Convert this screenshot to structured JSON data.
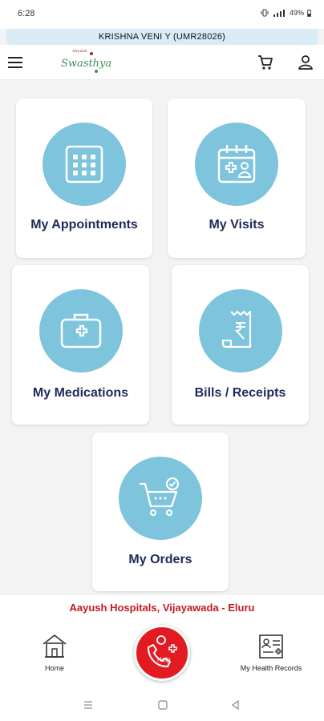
{
  "status": {
    "time": "6:28",
    "battery": "49%"
  },
  "patient": {
    "name": "KRISHNA VENI Y (UMR28026)"
  },
  "logo": {
    "small_text": "Aayush",
    "brand_text": "Swasthya"
  },
  "cards": [
    {
      "label": "My Appointments",
      "icon": "calendar-grid-icon"
    },
    {
      "label": "My Visits",
      "icon": "calendar-medical-icon"
    },
    {
      "label": "My Medications",
      "icon": "medical-kit-icon"
    },
    {
      "label": "Bills / Receipts",
      "icon": "rupee-receipt-icon"
    },
    {
      "label": "My Orders",
      "icon": "shopping-cart-check-icon"
    }
  ],
  "footer": {
    "hospital": "Aayush Hospitals,  Vijayawada - Eluru",
    "nav": {
      "home": "Home",
      "help": "Help",
      "records": "My Health Records"
    }
  },
  "colors": {
    "accent_circle": "#7ec4dc",
    "label": "#1f2a57",
    "hospital_text": "#c3191f",
    "help_button": "#e21b23"
  }
}
